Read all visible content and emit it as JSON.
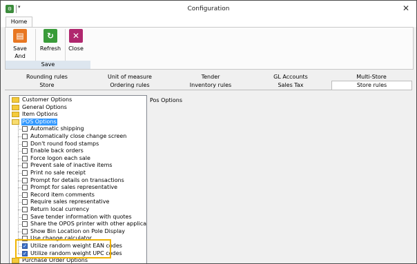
{
  "window": {
    "title": "Configuration",
    "close_glyph": "✕"
  },
  "ribbon": {
    "tab": "Home",
    "buttons": [
      {
        "label": "Save And Close",
        "icon": "save-icon",
        "color": "#e87722"
      },
      {
        "label": "Refresh",
        "icon": "refresh-icon",
        "color": "#3a9b3a"
      },
      {
        "label": "Close",
        "icon": "close-icon",
        "color": "#b0276e"
      }
    ],
    "group_label": "Save"
  },
  "tabs": {
    "top_row": [
      "Rounding rules",
      "Unit of measure",
      "Tender",
      "GL Accounts",
      "Multi-Store"
    ],
    "bottom_row": [
      "Store",
      "Ordering rules",
      "Inventory rules",
      "Sales Tax",
      "Store rules"
    ],
    "active": "Store rules"
  },
  "tree": {
    "folders_top": [
      "Customer Options",
      "General Options",
      "Item Options"
    ],
    "selected_folder": "POS Options",
    "pos_options": [
      {
        "label": "Automatic shipping",
        "checked": false
      },
      {
        "label": "Automatically close change screen",
        "checked": false
      },
      {
        "label": "Don't round food stamps",
        "checked": false
      },
      {
        "label": "Enable back orders",
        "checked": false
      },
      {
        "label": "Force logon each sale",
        "checked": false
      },
      {
        "label": "Prevent sale of inactive items",
        "checked": false
      },
      {
        "label": "Print no sale receipt",
        "checked": false
      },
      {
        "label": "Prompt for details on transactions",
        "checked": false
      },
      {
        "label": "Prompt for sales representative",
        "checked": false
      },
      {
        "label": "Record item comments",
        "checked": false
      },
      {
        "label": "Require sales representative",
        "checked": false
      },
      {
        "label": "Return local currency",
        "checked": false
      },
      {
        "label": "Save tender information with quotes",
        "checked": false
      },
      {
        "label": "Share the OPOS printer with other application",
        "checked": false
      },
      {
        "label": "Show Bin Location on Pole Display",
        "checked": false
      },
      {
        "label": "Use change calculator",
        "checked": false
      },
      {
        "label": "Utilize random weight EAN codes",
        "checked": true
      },
      {
        "label": "Utilize random weight UPC codes",
        "checked": true
      }
    ],
    "folders_bottom": [
      "Purchase Order Options"
    ]
  },
  "detail": {
    "heading": "Pos Options"
  },
  "colors": {
    "selection": "#3399ff",
    "highlight_border": "#f0b400",
    "group_label_bg": "#dde6ef"
  }
}
